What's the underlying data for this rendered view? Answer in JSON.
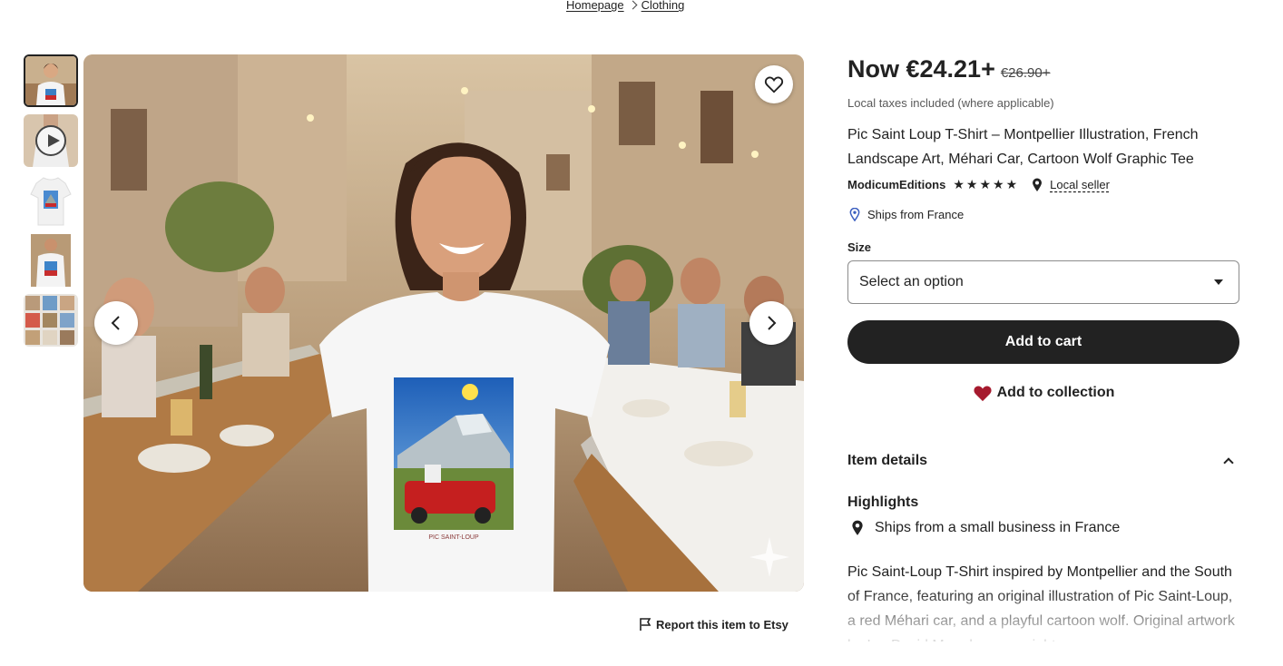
{
  "breadcrumb": {
    "items": [
      "Homepage",
      "Clothing"
    ]
  },
  "listing": {
    "price_now": "Now €24.21+",
    "price_original": "€26.90+",
    "taxes_note": "Local taxes included (where applicable)",
    "title": "Pic Saint Loup T-Shirt – Montpellier Illustration, French Landscape Art, Méhari Car, Cartoon Wolf Graphic Tee",
    "seller_name": "ModicumEditions",
    "rating_stars": 5,
    "local_seller_label": "Local seller",
    "ships_from": "Ships from France",
    "shirt_print_caption": "PIC SAINT-LOUP"
  },
  "size": {
    "label": "Size",
    "selected": "Select an option"
  },
  "actions": {
    "add_to_cart": "Add to cart",
    "add_to_collection": "Add to collection",
    "report": "Report this item to Etsy"
  },
  "details": {
    "section_title": "Item details",
    "highlights_title": "Highlights",
    "highlight_ships": "Ships from a small business in France",
    "description": "Pic Saint-Loup T-Shirt inspired by Montpellier and the South of France, featuring an original illustration of Pic Saint-Loup, a red Méhari car, and a playful cartoon wolf. Original artwork by Ian David Marsden, copyright"
  },
  "colors": {
    "primary_text": "#222222",
    "button_dark": "#222222",
    "heart_red": "#a61a2e",
    "ships_pin_blue": "#3b5fc0"
  },
  "icons": [
    "heart-icon",
    "chevron-left-icon",
    "chevron-right-icon",
    "play-icon",
    "star-icon",
    "location-pin-icon",
    "flag-icon",
    "chevron-up-icon",
    "caret-down-icon"
  ]
}
